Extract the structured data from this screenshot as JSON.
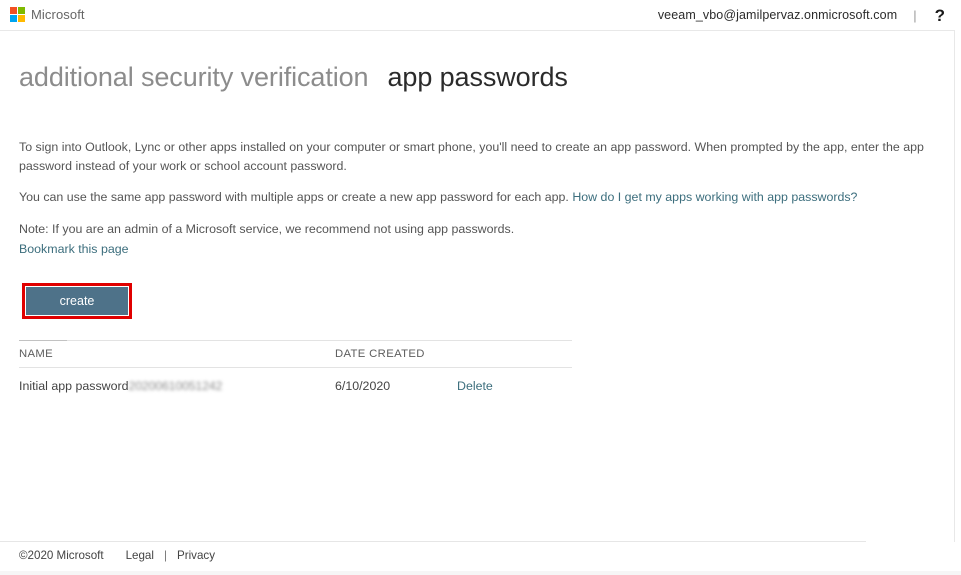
{
  "header": {
    "logo_label": "Microsoft",
    "logo_colors": [
      "#f25022",
      "#7fba00",
      "#00a4ef",
      "#ffb900"
    ],
    "account_email": "veeam_vbo@jamilpervaz.onmicrosoft.com",
    "separator": "|",
    "help_icon": "?"
  },
  "titles": {
    "main": "additional security verification",
    "sub": "app passwords"
  },
  "body": {
    "paragraph_1": "To sign into Outlook, Lync or other apps installed on your computer or smart phone, you'll need to create an app password. When prompted by the app, enter the app password instead of your work or school account password.",
    "paragraph_2_prefix": "You can use the same app password with multiple apps or create a new app password for each app. ",
    "paragraph_2_link": "How do I get my apps working with app passwords?",
    "paragraph_3": "Note: If you are an admin of a Microsoft service, we recommend not using app passwords.",
    "bookmark_link": "Bookmark this page"
  },
  "actions": {
    "create_label": "create",
    "create_button_color": "#4e7289",
    "annotation_color": "#e00000"
  },
  "table": {
    "columns": [
      "NAME",
      "DATE CREATED",
      ""
    ],
    "rows": [
      {
        "name": "Initial app password",
        "name_suffix_redacted": "20200610051242",
        "date_created": "6/10/2020",
        "action_label": "Delete"
      }
    ]
  },
  "footer": {
    "copyright": "©2020 Microsoft",
    "legal": "Legal",
    "separator": "|",
    "privacy": "Privacy"
  },
  "theme": {
    "link_color": "#3c6e7d",
    "title_muted": "#8c8c8c",
    "title_strong": "#2b2b2b"
  }
}
